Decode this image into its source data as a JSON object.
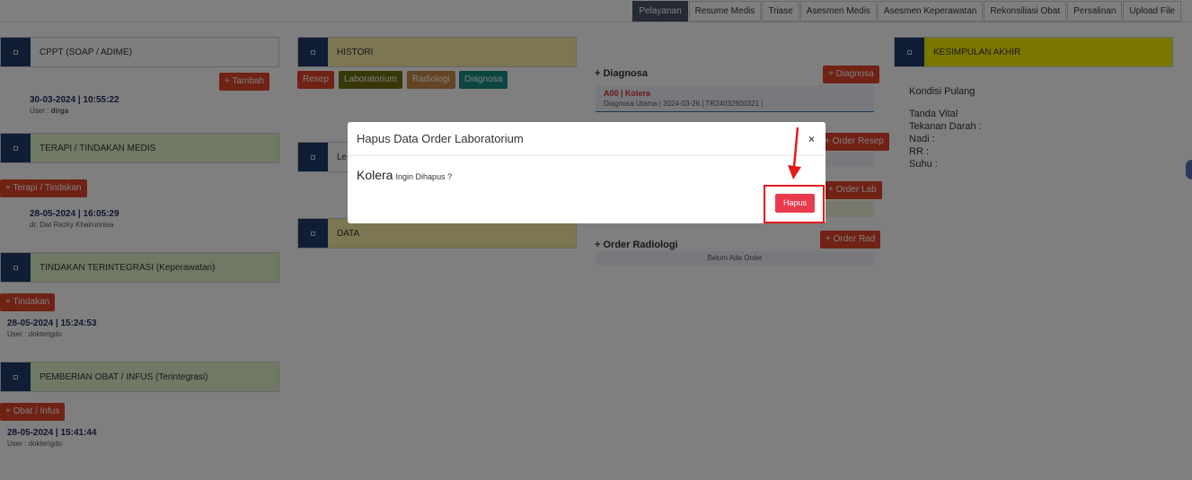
{
  "tabs": [
    "Pelayanan",
    "Resume Medis",
    "Triase",
    "Asesmen Medis",
    "Asesmen Keperawatan",
    "Rekonsiliasi Obat",
    "Persalinan",
    "Upload File"
  ],
  "active_tab": "Pelayanan",
  "left_column": {
    "cppt": {
      "title": "CPPT (SOAP / ADIME)",
      "add_button": "+ Tambah",
      "date": "30-03-2024 | 10:55:22",
      "user_label": "User :",
      "user": "dirga"
    },
    "terapi": {
      "title": "TERAPI / TINDAKAN MEDIS",
      "add_button": "+ Terapi / Tindakan",
      "date": "28-05-2024 | 16:05:29",
      "doctor": "dr. Dwi Rezky Khairunnisa"
    },
    "tindakan": {
      "title": "TINDAKAN TERINTEGRASI (Keperawatan)",
      "add_button": "+ Tindakan",
      "date": "28-05-2024 | 15:24:53",
      "user_label": "User :",
      "user": "dokterigdo"
    },
    "obat": {
      "title": "PEMBERIAN OBAT / INFUS (Terintegrasi)",
      "add_button": "+ Obat / Infus",
      "date": "28-05-2024 | 15:41:44",
      "user_label": "User :",
      "user": "dokterigdo"
    }
  },
  "middle_column": {
    "histori": {
      "title": "HISTORI",
      "buttons": [
        "Resep",
        "Laboratorium",
        "Radiologi",
        "Diagnosa"
      ]
    },
    "second_panel_label": "Le",
    "data_panel_title": "DATA"
  },
  "orders_column": {
    "diagnosa_title": "+ Diagnosa",
    "diagnosa_button": "+ Diagnosa",
    "diagnosa_code": "A00 | Kolera",
    "diagnosa_sub": "Diagnosa Utama | 2024-03-26 | TR24032600321 |",
    "resep_button": "+ Order Resep",
    "lab_button": "+ Order Lab",
    "radiologi_title": "+ Order Radiologi",
    "radiologi_button": "+ Order Rad",
    "radiologi_empty": "Belum Ada Order"
  },
  "right_column": {
    "title": "KESIMPULAN AKHIR",
    "kondisi": "Kondisi Pulang",
    "vital_title": "Tanda Vital",
    "tekanan": "Tekanan Darah :",
    "nadi": "Nadi :",
    "rr": "RR :",
    "suhu": "Suhu :"
  },
  "modal": {
    "title": "Hapus Data Order Laboratorium",
    "close": "×",
    "item_name": "Kolera",
    "question": "Ingin Dihapus ?",
    "confirm_button": "Hapus"
  },
  "colors": {
    "overlay": "rgba(0,0,0,0.5)",
    "accent_red": "#e0442b",
    "hapus_button": "#ea3a4e",
    "navy": "#1f3a6b",
    "annotation": "#e31b1b"
  }
}
